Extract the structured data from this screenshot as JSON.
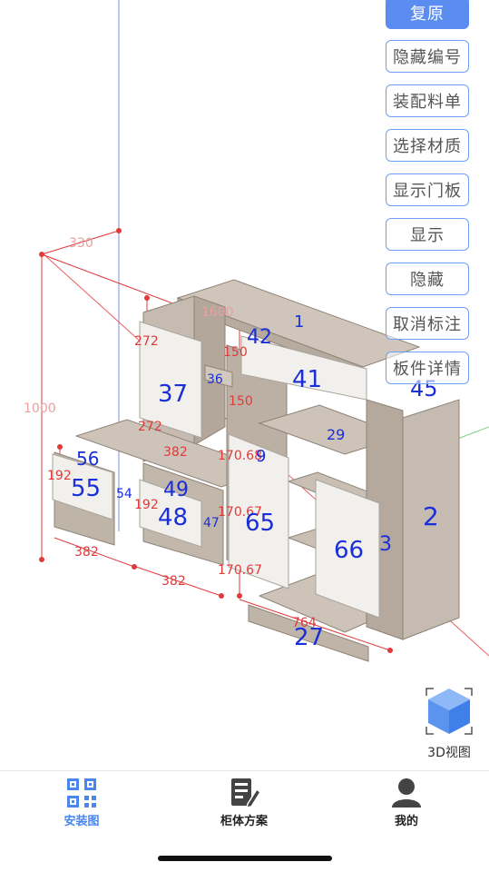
{
  "toolbar": {
    "reset": "复原",
    "hide_numbers": "隐藏编号",
    "assembly_list": "装配料单",
    "select_material": "选择材质",
    "show_doors": "显示门板",
    "show": "显示",
    "hide": "隐藏",
    "cancel_marks": "取消标注",
    "panel_detail": "板件详情"
  },
  "view3d_label": "3D视图",
  "tabs": [
    {
      "label": "安装图",
      "icon": "qr-code-icon",
      "active": true
    },
    {
      "label": "柜体方案",
      "icon": "plan-edit-icon",
      "active": false
    },
    {
      "label": "我的",
      "icon": "user-icon",
      "active": false
    }
  ],
  "colors": {
    "accent": "#5b8df0",
    "wood": "#c9bfb5",
    "dimension": "#e03a3a",
    "part_number": "#1a2fd6"
  },
  "dimensions": [
    "330",
    "1600",
    "1000",
    "272",
    "150",
    "150",
    "272",
    "382",
    "170.68",
    "192",
    "192",
    "170.67",
    "170.67",
    "382",
    "382",
    "764"
  ],
  "part_numbers": [
    "1",
    "42",
    "41",
    "37",
    "36",
    "45",
    "29",
    "56",
    "55",
    "54",
    "49",
    "48",
    "47",
    "65",
    "66",
    "3",
    "2",
    "27",
    "9"
  ]
}
